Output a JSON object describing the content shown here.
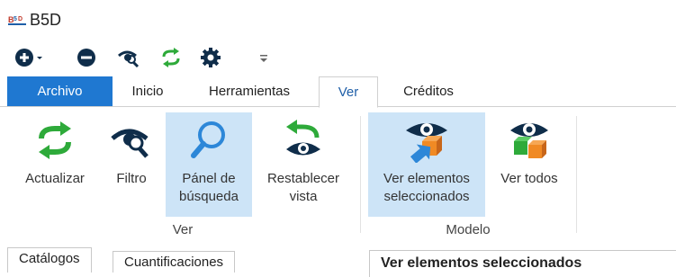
{
  "app": {
    "title": "B5D",
    "logo_text": "B5D"
  },
  "quick_access": {
    "items": [
      {
        "icon": "add-circle-dropdown-icon"
      },
      {
        "icon": "remove-circle-icon"
      },
      {
        "icon": "eye-filter-icon"
      },
      {
        "icon": "refresh-icon"
      },
      {
        "icon": "gear-icon"
      },
      {
        "icon": "customize-dropdown-icon"
      }
    ]
  },
  "tabs": {
    "file": "Archivo",
    "home": "Inicio",
    "tools": "Herramientas",
    "view": "Ver",
    "credits": "Créditos",
    "active": "Ver"
  },
  "ribbon": {
    "ver_group": {
      "label": "Ver",
      "buttons": [
        {
          "label_line1": "Actualizar",
          "label_line2": "",
          "icon": "refresh-icon"
        },
        {
          "label_line1": "Filtro",
          "label_line2": "",
          "icon": "eye-filter-icon"
        },
        {
          "label_line1": "Pánel de",
          "label_line2": "búsqueda",
          "icon": "magnifier-icon",
          "highlighted": true
        },
        {
          "label_line1": "Restablecer",
          "label_line2": "vista",
          "icon": "reset-view-icon"
        }
      ]
    },
    "modelo_group": {
      "label": "Modelo",
      "buttons": [
        {
          "label_line1": "Ver elementos",
          "label_line2": "seleccionados",
          "icon": "eye-selected-icon",
          "highlighted": true
        },
        {
          "label_line1": "Ver todos",
          "label_line2": "",
          "icon": "eye-all-icon"
        }
      ]
    }
  },
  "bottom": {
    "tabs": [
      "Catálogos",
      "Cuantificaciones"
    ],
    "panel_title": "Ver elementos seleccionados"
  },
  "colors": {
    "file_tab": "#1f78d1",
    "accent_green": "#2eaa3a",
    "highlight": "#cde4f7",
    "dark_icon": "#0f2d4a"
  }
}
